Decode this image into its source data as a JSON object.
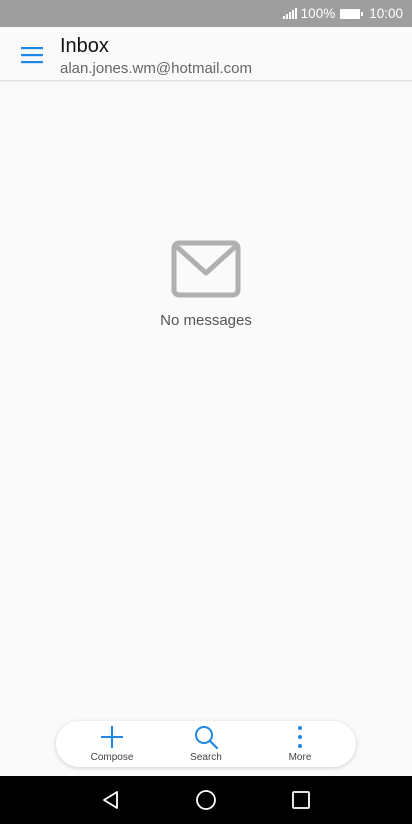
{
  "status_bar": {
    "battery_percent": "100%",
    "time": "10:00"
  },
  "header": {
    "title": "Inbox",
    "account": "alan.jones.wm@hotmail.com",
    "menu_icon": "hamburger-menu-icon"
  },
  "empty_state": {
    "icon": "envelope-icon",
    "message": "No messages"
  },
  "toolbar": {
    "compose_label": "Compose",
    "search_label": "Search",
    "more_label": "More"
  },
  "nav_bar": {
    "back_icon": "back-triangle-icon",
    "home_icon": "home-circle-icon",
    "recents_icon": "recents-square-icon"
  },
  "colors": {
    "accent": "#1e88e5",
    "status_bar": "#9e9e9e",
    "background": "#fafafa",
    "icon_gray": "#b0b0b0"
  }
}
